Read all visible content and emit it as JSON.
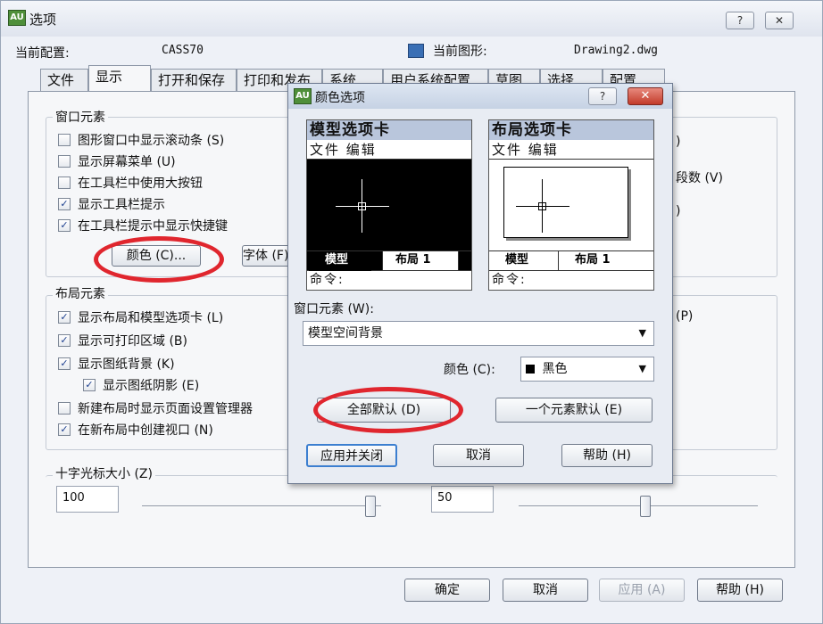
{
  "window": {
    "title": "选项",
    "help_btn": "?",
    "close_btn": "✕"
  },
  "config": {
    "current_profile_label": "当前配置:",
    "current_profile_value": "CASS70",
    "current_drawing_label": "当前图形:",
    "current_drawing_value": "Drawing2.dwg"
  },
  "tabs": [
    "文件",
    "显示",
    "打开和保存",
    "打印和发布",
    "系统",
    "用户系统配置",
    "草图",
    "选择",
    "配置"
  ],
  "window_elements": {
    "legend": "窗口元素",
    "items": [
      {
        "label": "图形窗口中显示滚动条 (S)",
        "checked": false
      },
      {
        "label": "显示屏幕菜单 (U)",
        "checked": false
      },
      {
        "label": "在工具栏中使用大按钮",
        "checked": false
      },
      {
        "label": "显示工具栏提示",
        "checked": true
      },
      {
        "label": "在工具栏提示中显示快捷键",
        "checked": true
      }
    ],
    "color_btn": "颜色 (C)...",
    "font_btn": "字体 (F)..."
  },
  "layout_elements": {
    "legend": "布局元素",
    "items": [
      {
        "label": "显示布局和模型选项卡 (L)",
        "checked": true
      },
      {
        "label": "显示可打印区域 (B)",
        "checked": true
      },
      {
        "label": "显示图纸背景 (K)",
        "checked": true
      },
      {
        "label": "显示图纸阴影 (E)",
        "checked": true
      },
      {
        "label": "新建布局时显示页面设置管理器",
        "checked": false
      },
      {
        "label": "在新布局中创建视口 (N)",
        "checked": true
      }
    ]
  },
  "right_partial": {
    "line1": ")",
    "line2": "段数 (V)",
    "line3": ")",
    "line4": "(P)"
  },
  "crosshair": {
    "legend": "十字光标大小 (Z)",
    "value": "100",
    "level_percent": 100
  },
  "fade": {
    "value": "50",
    "level_percent": 50
  },
  "bottom_buttons": {
    "ok": "确定",
    "cancel": "取消",
    "apply": "应用 (A)",
    "help": "帮助 (H)"
  },
  "color_dialog": {
    "title": "颜色选项",
    "help_btn": "?",
    "close_btn": "✕",
    "model_preview": {
      "header": "模型选项卡",
      "menu": "文件 编辑",
      "tab_model": "模型",
      "tab_layout": "布局 1",
      "cmd": "命令:"
    },
    "layout_preview": {
      "header": "布局选项卡",
      "menu": "文件 编辑",
      "tab_model": "模型",
      "tab_layout": "布局 1",
      "cmd": "命令:"
    },
    "element_label": "窗口元素 (W):",
    "element_value": "模型空间背景",
    "color_label": "颜色 (C):",
    "color_value": "黑色",
    "restore_all": "全部默认 (D)",
    "restore_one": "一个元素默认 (E)",
    "apply_close": "应用并关闭",
    "cancel": "取消",
    "help": "帮助 (H)"
  },
  "colors": {
    "highlight": "#e0262e",
    "model_bg": "#000000",
    "accent": "#b9c6dc"
  }
}
